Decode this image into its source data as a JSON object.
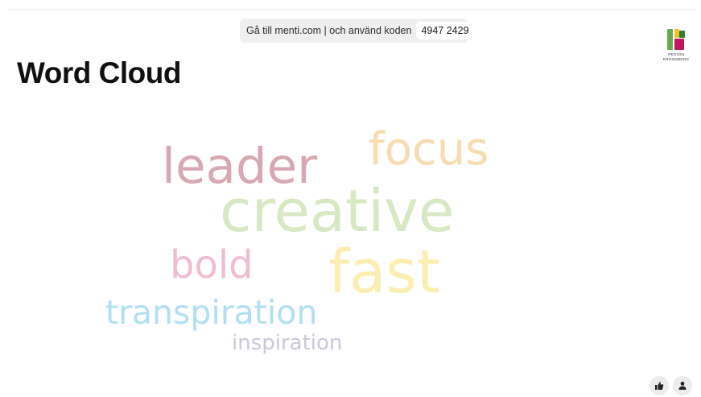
{
  "join_bar": {
    "instruction": "Gå till menti.com | och använd koden",
    "code": "4947 2429"
  },
  "logo": {
    "line1": "REGION",
    "line2": "KRONOBERG",
    "colors": [
      "#6aa84f",
      "#c2185b",
      "#f1c232",
      "#2e7d32"
    ]
  },
  "slide": {
    "title": "Word Cloud"
  },
  "word_cloud": {
    "words": [
      {
        "text": "leader",
        "color": "#d7a8b2"
      },
      {
        "text": "focus",
        "color": "#f6dcae"
      },
      {
        "text": "creative",
        "color": "#d7e8c3"
      },
      {
        "text": "bold",
        "color": "#f0bcd3"
      },
      {
        "text": "fast",
        "color": "#fbeeb0"
      },
      {
        "text": "transpiration",
        "color": "#b0dff3"
      },
      {
        "text": "inspiration",
        "color": "#c9c7d9"
      }
    ]
  },
  "controls": {
    "icons": [
      "thumbs-up-icon",
      "user-icon"
    ]
  }
}
